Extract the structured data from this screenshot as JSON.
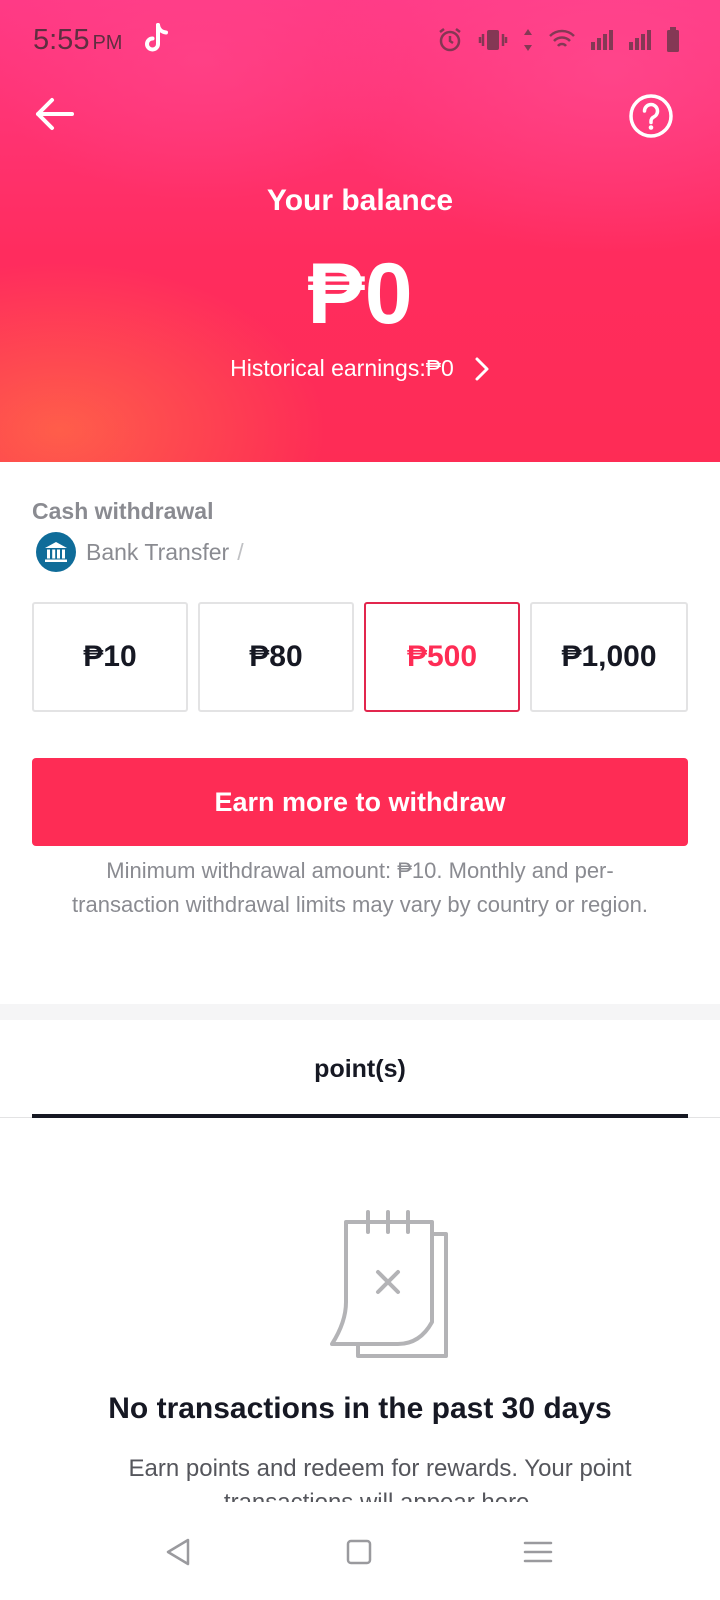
{
  "status_bar": {
    "time": "5:55",
    "ampm": "PM",
    "icons": [
      "tiktok-icon",
      "alarm-icon",
      "vibrate-icon",
      "data-arrows-icon",
      "wifi-icon",
      "signal-icon",
      "signal-icon",
      "battery-icon"
    ]
  },
  "header": {
    "back_icon": "arrow-left-icon",
    "help_icon": "question-circle-icon",
    "balance_label": "Your balance",
    "balance_value": "₱0",
    "historical_earnings": "Historical earnings:₱0",
    "gradient_colors": [
      "#ff3a86",
      "#fe2c55",
      "#ff6e46"
    ]
  },
  "withdrawal": {
    "title": "Cash withdrawal",
    "method_label": "Bank Transfer",
    "method_separator": "/",
    "amounts": [
      {
        "label": "₱10",
        "selected": false
      },
      {
        "label": "₱80",
        "selected": false
      },
      {
        "label": "₱500",
        "selected": true
      },
      {
        "label": "₱1,000",
        "selected": false
      }
    ],
    "button_label": "Earn more to withdraw",
    "note": "Minimum withdrawal amount: ₱10. Monthly and per-transaction withdrawal limits may vary by country or region.",
    "accent_color": "#fe2c55"
  },
  "tabs": [
    {
      "label": "point(s)",
      "active": true
    }
  ],
  "empty_state": {
    "icon": "calendar-x-icon",
    "title": "No transactions in the past 30 days",
    "description": "Earn points and redeem for rewards. Your point transactions will appear here."
  },
  "nav_bar": {
    "icons": [
      "nav-back-icon",
      "nav-home-icon",
      "nav-menu-icon"
    ]
  }
}
